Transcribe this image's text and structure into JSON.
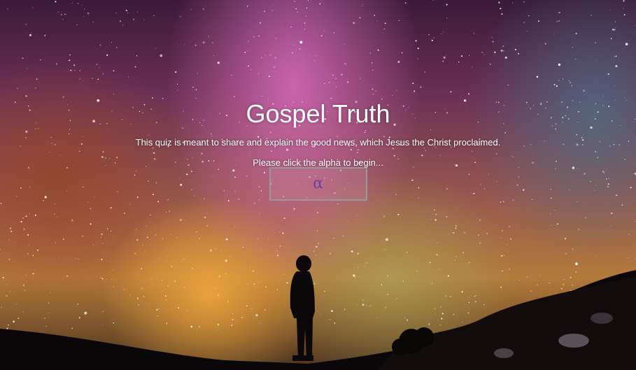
{
  "page": {
    "title": "Gospel Truth",
    "description": "This quiz is meant to share and explain the good news, which Jesus the Christ proclaimed.",
    "instruction": "Please click the alpha to begin...",
    "start_button_label": "α"
  },
  "background": {
    "scene": "starry-night-sky-with-silhouette",
    "colors": {
      "accent": "#6a3da0",
      "button_border": "#9a9a9a",
      "text": "#ffffff"
    }
  }
}
